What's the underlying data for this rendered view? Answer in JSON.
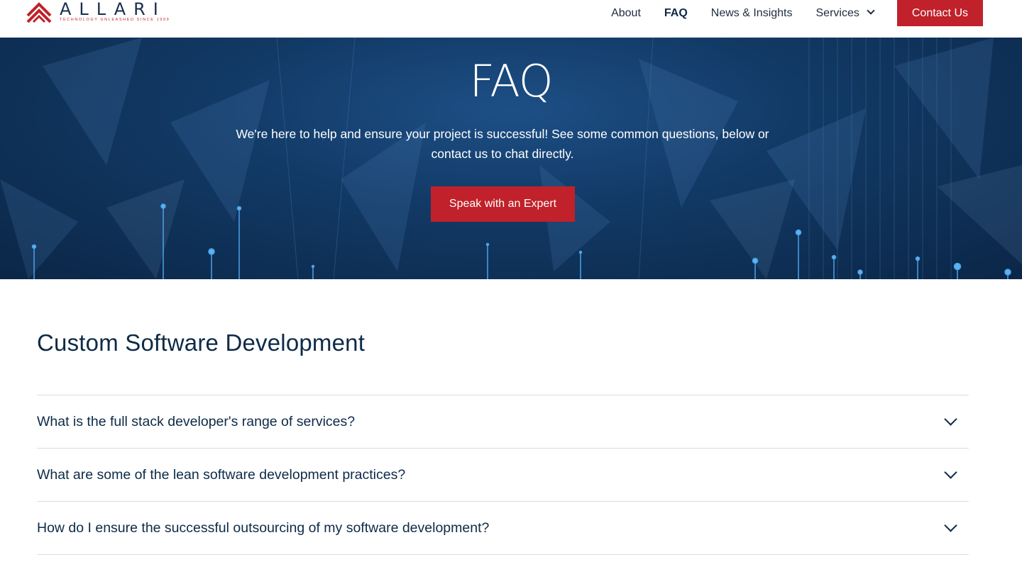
{
  "header": {
    "logo": {
      "word": "ALLARI",
      "tagline": "TECHNOLOGY UNLEASHED SINCE 1999",
      "brand_color": "#c0212a"
    },
    "nav": [
      {
        "label": "About",
        "active": false
      },
      {
        "label": "FAQ",
        "active": true
      },
      {
        "label": "News & Insights",
        "active": false
      },
      {
        "label": "Services",
        "active": false,
        "has_dropdown": true
      }
    ],
    "contact_label": "Contact Us"
  },
  "hero": {
    "title": "FAQ",
    "subtitle": "We're here to help and ensure your project is successful!  See some common questions, below or contact us to chat directly.",
    "cta_label": "Speak with an Expert"
  },
  "section": {
    "title": "Custom Software Development",
    "questions": [
      "What is the full stack developer's range of services?",
      "What are some of the lean software development practices?",
      "How do I ensure the successful outsourcing of my software development?"
    ]
  },
  "colors": {
    "accent": "#c0212a",
    "navy": "#0e2a47",
    "hero_bg": "#123a66"
  },
  "icons": {
    "dropdown": "chevron-down-icon",
    "faq_toggle": "chevron-down-icon",
    "logo": "allari-logo-mark"
  }
}
